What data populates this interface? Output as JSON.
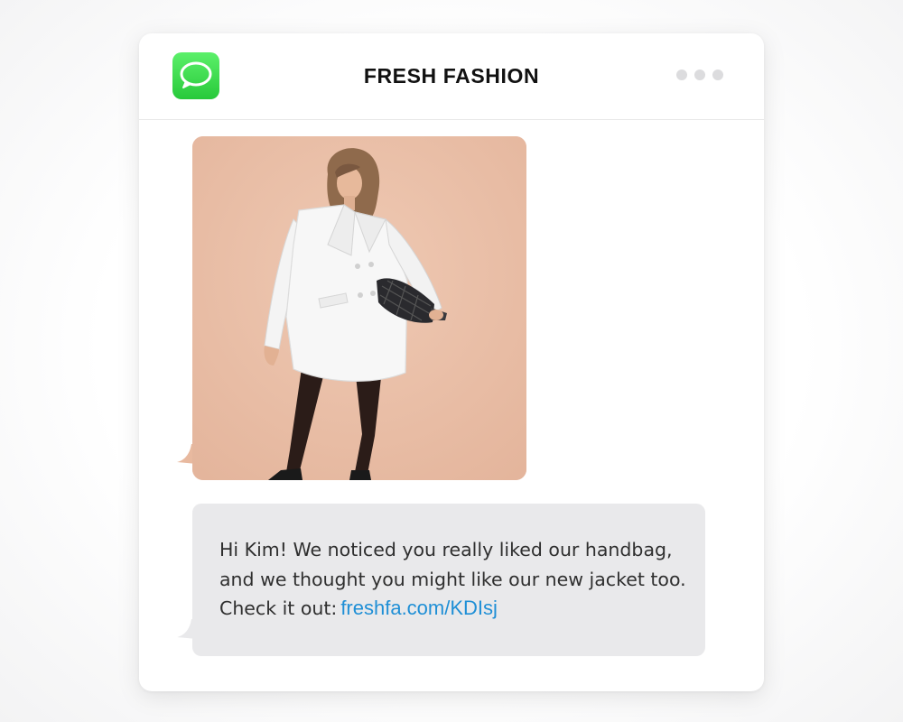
{
  "header": {
    "title": "FRESH FASHION",
    "app_icon": "messages-app-icon",
    "menu_icon": "more-options-dots-icon"
  },
  "messages": {
    "image_message": {
      "description_icon": "model-in-white-oversized-blazer-photo",
      "background_color": "#ebc3ac"
    },
    "text_message": {
      "line1": "Hi Kim! We noticed you really liked our handbag,",
      "line2": "and we thought you might like our new  jacket too.",
      "line3_prefix": "Check it out:",
      "link_text": "freshfa.com/KDIsj"
    }
  },
  "colors": {
    "bubble_gray": "#e9e9eb",
    "link_blue": "#1f8fd6",
    "icon_green": "#34c759"
  }
}
